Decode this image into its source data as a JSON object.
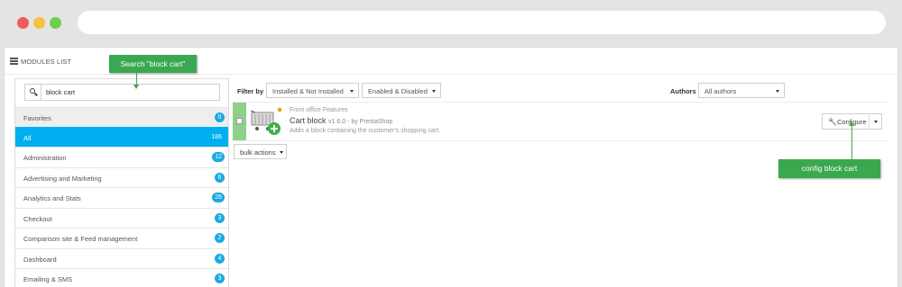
{
  "panel": {
    "title": "MODULES LIST"
  },
  "search": {
    "value": "block cart"
  },
  "categories": [
    {
      "label": "Favorites",
      "count": "0"
    },
    {
      "label": "All",
      "count": "186"
    },
    {
      "label": "Administration",
      "count": "12"
    },
    {
      "label": "Advertising and Marketing",
      "count": "6"
    },
    {
      "label": "Analytics and Stats",
      "count": "26"
    },
    {
      "label": "Checkout",
      "count": "3"
    },
    {
      "label": "Comparison site & Feed management",
      "count": "2"
    },
    {
      "label": "Dashboard",
      "count": "4"
    },
    {
      "label": "Emailing & SMS",
      "count": "3"
    }
  ],
  "filter": {
    "label": "Filter by",
    "install_status": "Installed & Not Installed",
    "enable_status": "Enabled & Disabled",
    "authors_label": "Authors",
    "authors_value": "All authors"
  },
  "module": {
    "category": "Front office Features",
    "name": "Cart block",
    "version": "v1.6.0 - by PrestaShop",
    "description": "Adds a block containing the customer's shopping cart.",
    "configure_label": "Configure"
  },
  "bulk_actions_label": "bulk actions",
  "annotations": {
    "search_note": "Search \"block cart\"",
    "config_note": "config block cart"
  },
  "colors": {
    "active_category": "#00aff0",
    "count_badge": "#1ba9e1",
    "installed_marker": "#8ed08a",
    "annotation": "#3aa84f"
  }
}
